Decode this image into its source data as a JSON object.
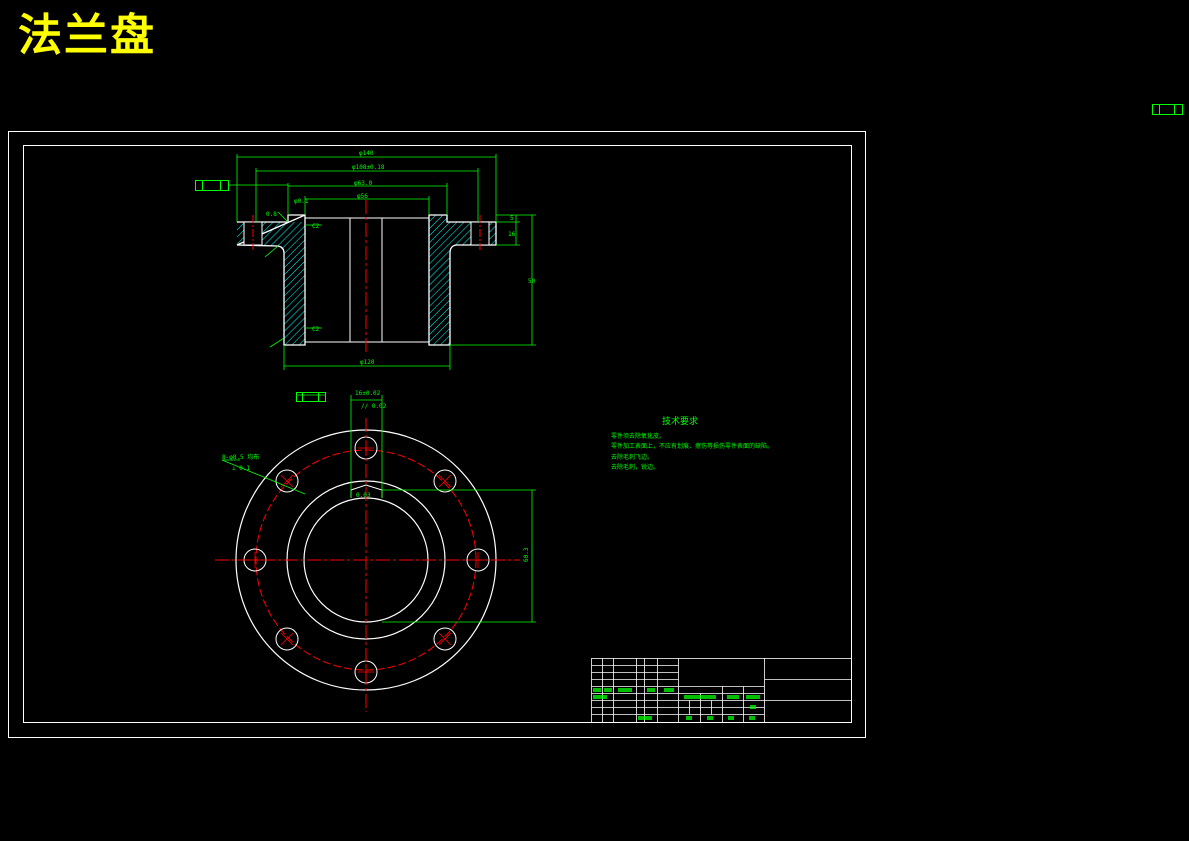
{
  "title": "法兰盘",
  "colors": {
    "background": "#000000",
    "title": "#ffff00",
    "outline": "#ffffff",
    "dimension": "#00ff00",
    "centerline": "#ff0000"
  },
  "tech_requirements": {
    "heading": "技术要求",
    "lines": [
      "零件须去除氧化皮。",
      "零件加工表面上，不应有划痕、擦伤等损伤零件表面的缺陷。",
      "去除毛刺飞边。",
      "去除毛刺，锐边。"
    ]
  }
}
